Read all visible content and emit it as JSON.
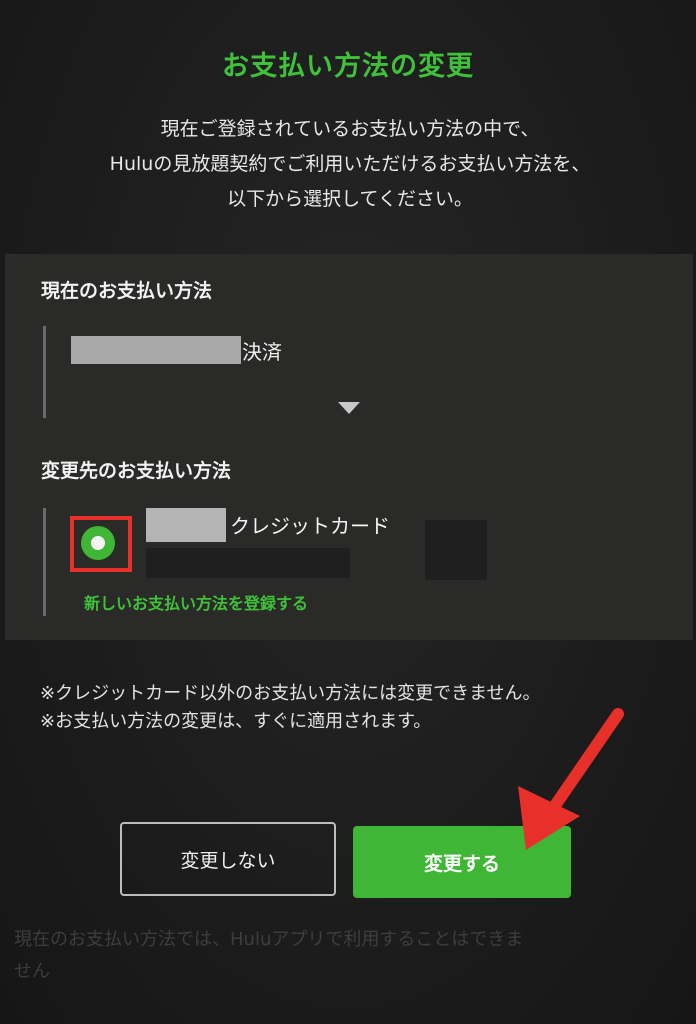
{
  "dialog": {
    "title": "お支払い方法の変更",
    "intro_lines": [
      "現在ご登録されているお支払い方法の中で、",
      "Huluの見放題契約でご利用いただけるお支払い方法を、",
      "以下から選択してください。"
    ]
  },
  "current_method": {
    "label": "現在のお支払い方法",
    "value_suffix": "決済"
  },
  "new_method": {
    "label": "変更先のお支払い方法",
    "option_suffix": "クレジットカード",
    "selected": true,
    "register_link": "新しいお支払い方法を登録する"
  },
  "notes": [
    "※クレジットカード以外のお支払い方法には変更できません。",
    "※お支払い方法の変更は、すぐに適用されます。"
  ],
  "buttons": {
    "cancel_label": "変更しない",
    "confirm_label": "変更する"
  },
  "background_text": {
    "line1": "現在のお支払い方法では、Huluアプリで利用することはできま",
    "line2": "せん"
  },
  "colors": {
    "accent_green": "#3fb636",
    "highlight_red": "#e8302a",
    "panel_background": "#2a2a28"
  }
}
